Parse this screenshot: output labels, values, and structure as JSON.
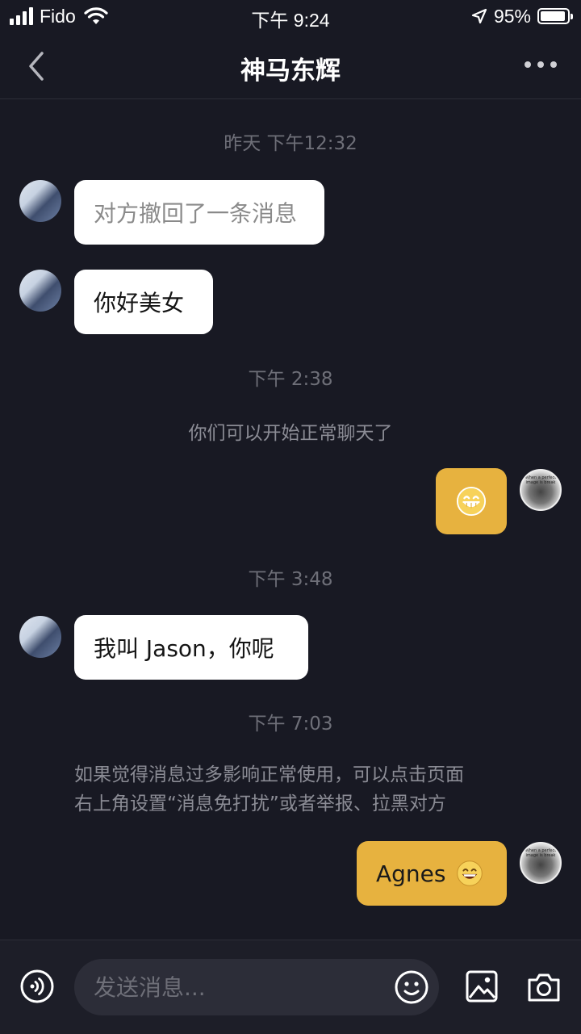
{
  "status_bar": {
    "carrier": "Fido",
    "time": "下午 9:24",
    "battery": "95%",
    "battery_level": 0.95
  },
  "header": {
    "title": "神马东辉",
    "back_icon": "chevron-left-icon",
    "more_icon": "more-dots-icon"
  },
  "messages": {
    "ts1": "昨天 下午12:32",
    "m1": "对方撤回了一条消息",
    "m2": "你好美女",
    "ts2": "下午 2:38",
    "sys1": "你们可以开始正常聊天了",
    "ts3": "下午 3:48",
    "m4": "我叫 Jason，你呢",
    "ts4": "下午 7:03",
    "sys2_line1": "如果觉得消息过多影响正常使用，可以点击页面",
    "sys2_line2": "右上角设置“消息免打扰”或者举报、拉黑对方",
    "m5": "Agnes",
    "self_avatar_caption": "When a perfect image is break"
  },
  "input_bar": {
    "placeholder": "发送消息...",
    "icons": [
      "voice-icon",
      "emoji-icon",
      "image-icon",
      "camera-icon"
    ]
  },
  "colors": {
    "background": "#181923",
    "incoming_bubble": "#ffffff",
    "outgoing_bubble": "#e7b23f",
    "timestamp": "#6e6f78"
  }
}
